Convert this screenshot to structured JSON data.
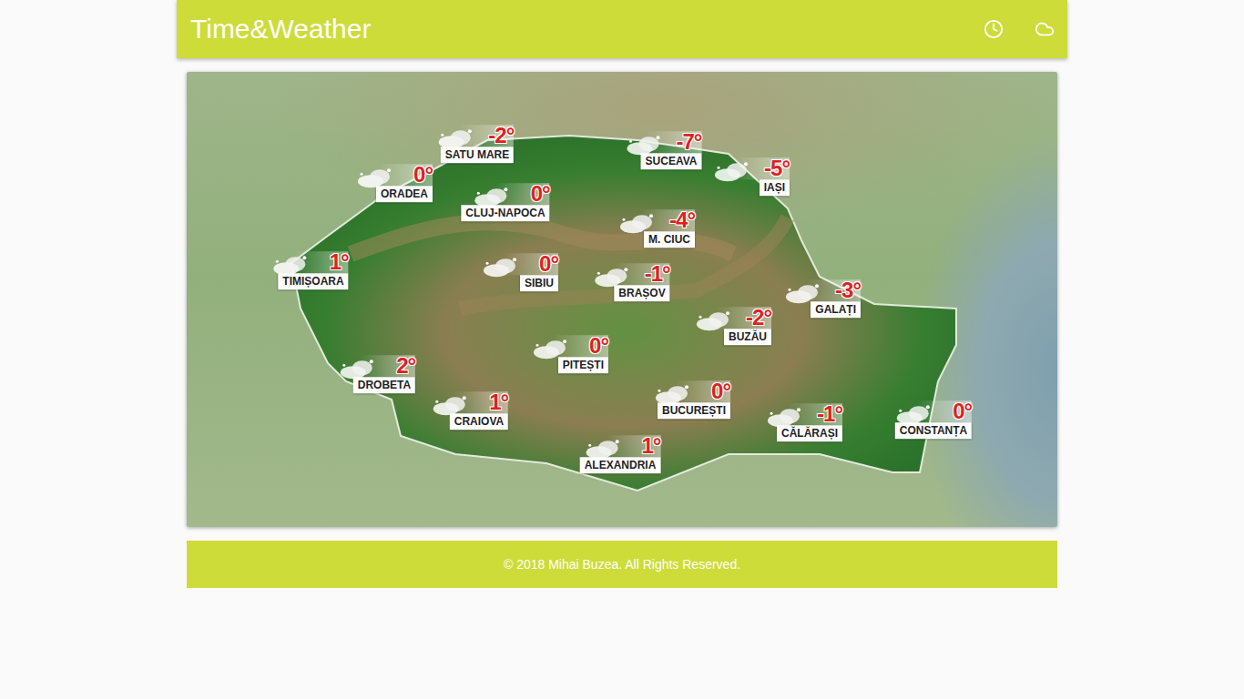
{
  "header": {
    "title": "Time&Weather"
  },
  "map": {
    "cities": [
      {
        "name": "SATU MARE",
        "temp": "-2°"
      },
      {
        "name": "SUCEAVA",
        "temp": "-7°"
      },
      {
        "name": "IAȘI",
        "temp": "-5°"
      },
      {
        "name": "ORADEA",
        "temp": "0°"
      },
      {
        "name": "CLUJ-NAPOCA",
        "temp": "0°"
      },
      {
        "name": "M. CIUC",
        "temp": "-4°"
      },
      {
        "name": "TIMIȘOARA",
        "temp": "1°"
      },
      {
        "name": "SIBIU",
        "temp": "0°"
      },
      {
        "name": "BRAȘOV",
        "temp": "-1°"
      },
      {
        "name": "GALAȚI",
        "temp": "-3°"
      },
      {
        "name": "BUZĂU",
        "temp": "-2°"
      },
      {
        "name": "DROBETA",
        "temp": "2°"
      },
      {
        "name": "PITEȘTI",
        "temp": "0°"
      },
      {
        "name": "BUCUREȘTI",
        "temp": "0°"
      },
      {
        "name": "CRAIOVA",
        "temp": "1°"
      },
      {
        "name": "CĂLĂRAȘI",
        "temp": "-1°"
      },
      {
        "name": "CONSTANȚA",
        "temp": "0°"
      },
      {
        "name": "ALEXANDRIA",
        "temp": "1°"
      }
    ]
  },
  "footer": {
    "text": "© 2018 Mihai Buzea. All Rights Reserved."
  }
}
